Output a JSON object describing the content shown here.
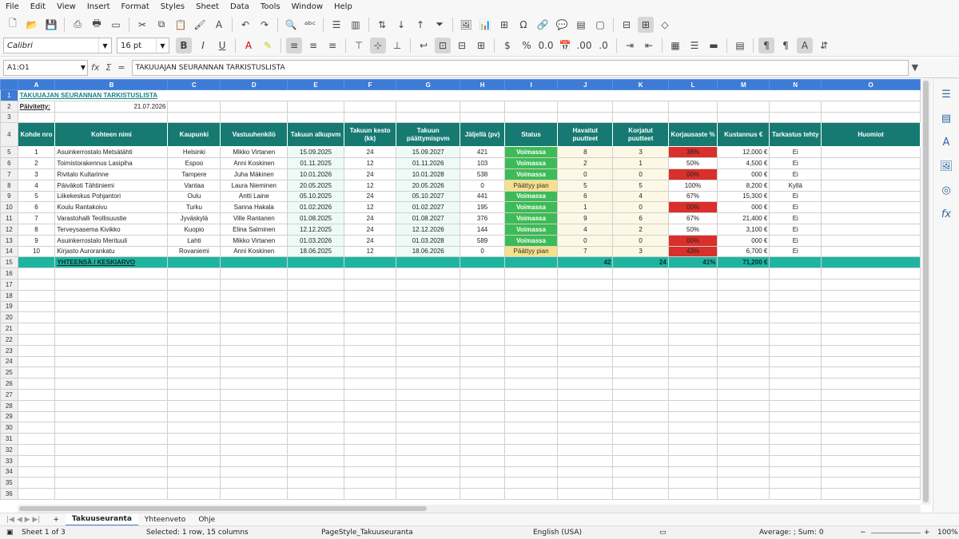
{
  "menu": [
    "File",
    "Edit",
    "View",
    "Insert",
    "Format",
    "Styles",
    "Sheet",
    "Data",
    "Tools",
    "Window",
    "Help"
  ],
  "font": {
    "name": "Calibri",
    "size": "16 pt"
  },
  "namebox": "A1:O1",
  "formula": "TAKUUAJAN SEURANNAN TARKISTUSLISTA",
  "columns": [
    "A",
    "B",
    "C",
    "D",
    "E",
    "F",
    "G",
    "H",
    "I",
    "J",
    "K",
    "L",
    "M",
    "N",
    "O"
  ],
  "sheet": {
    "title": "TAKUUAJAN SEURANNAN TARKISTUSLISTA",
    "updated_label": "Päivitetty:",
    "updated_value": "21.07.2026",
    "headers": [
      "Kohde nro",
      "Kohteen nimi",
      "Kaupunki",
      "Vastuuhenkilö",
      "Takuun alkupvm",
      "Takuun kesto (kk)",
      "Takuun päättymispvm",
      "Jäljellä (pv)",
      "Status",
      "Havaitut puutteet",
      "Korjatut puutteet",
      "Korjausaste %",
      "Kustannus €",
      "Tarkastus tehty",
      "Huomiot"
    ],
    "rows": [
      [
        "1",
        "Asuinkerrostalo Metsätähti",
        "Helsinki",
        "Mikko Virtanen",
        "15.09.2025",
        "24",
        "15.09.2027",
        "421",
        "Voimassa",
        "8",
        "3",
        "38%",
        "12,000 €",
        "Ei",
        ""
      ],
      [
        "2",
        "Toimistorakennus Lasipiha",
        "Espoo",
        "Anni Koskinen",
        "01.11.2025",
        "12",
        "01.11.2026",
        "103",
        "Voimassa",
        "2",
        "1",
        "50%",
        "4,500 €",
        "Ei",
        ""
      ],
      [
        "3",
        "Rivitalo Kultarinne",
        "Tampere",
        "Juha Mäkinen",
        "10.01.2026",
        "24",
        "10.01.2028",
        "538",
        "Voimassa",
        "0",
        "0",
        "00%",
        "000 €",
        "Ei",
        ""
      ],
      [
        "4",
        "Päiväkoti Tähtiniemi",
        "Vantaa",
        "Laura Nieminen",
        "20.05.2025",
        "12",
        "20.05.2026",
        "0",
        "Päättyy pian",
        "5",
        "5",
        "100%",
        "8,200 €",
        "Kyllä",
        ""
      ],
      [
        "5",
        "Liikekeskus Pohjantori",
        "Oulu",
        "Antti Laine",
        "05.10.2025",
        "24",
        "05.10.2027",
        "441",
        "Voimassa",
        "6",
        "4",
        "67%",
        "15,300 €",
        "Ei",
        ""
      ],
      [
        "6",
        "Koulu Rantakoivu",
        "Turku",
        "Sanna Hakala",
        "01.02.2026",
        "12",
        "01.02.2027",
        "195",
        "Voimassa",
        "1",
        "0",
        "00%",
        "000 €",
        "Ei",
        ""
      ],
      [
        "7",
        "Varastohalli Teollisuustie",
        "Jyväskylä",
        "Ville Rantanen",
        "01.08.2025",
        "24",
        "01.08.2027",
        "376",
        "Voimassa",
        "9",
        "6",
        "67%",
        "21,400 €",
        "Ei",
        ""
      ],
      [
        "8",
        "Terveysasema Kivikko",
        "Kuopio",
        "Elina Salminen",
        "12.12.2025",
        "24",
        "12.12.2026",
        "144",
        "Voimassa",
        "4",
        "2",
        "50%",
        "3,100 €",
        "Ei",
        ""
      ],
      [
        "9",
        "Asuinkerrostalo Merituuli",
        "Lahti",
        "Mikko Virtanen",
        "01.03.2026",
        "24",
        "01.03.2028",
        "589",
        "Voimassa",
        "0",
        "0",
        "00%",
        "000 €",
        "Ei",
        ""
      ],
      [
        "10",
        "Kirjasto Aurorankatu",
        "Rovaniemi",
        "Anni Koskinen",
        "18.06.2025",
        "12",
        "18.06.2026",
        "0",
        "Päättyy pian",
        "7",
        "3",
        "43%",
        "6,700 €",
        "Ei",
        ""
      ]
    ],
    "low_rate_rows": [
      0,
      2,
      5,
      8,
      9
    ],
    "total": {
      "label": "YHTEENSÄ / KESKIARVO",
      "found": "42",
      "fixed": "24",
      "rate": "41%",
      "cost": "71,200 €"
    }
  },
  "tabs": [
    "Takuuseuranta",
    "Yhteenveto",
    "Ohje"
  ],
  "active_tab": "Takuuseuranta",
  "status": {
    "sheet": "Sheet 1 of 3",
    "selection": "Selected: 1 row, 15 columns",
    "pagestyle": "PageStyle_Takuuseuranta",
    "language": "English (USA)",
    "sum": "Average: ; Sum: 0",
    "zoom": "100%"
  },
  "colors": {
    "header": "#167a72",
    "total": "#1eb5a0",
    "ok": "#3dbb56",
    "soon": "#f6e08a",
    "low": "#d9302b",
    "colhead": "#3d7bd6"
  }
}
